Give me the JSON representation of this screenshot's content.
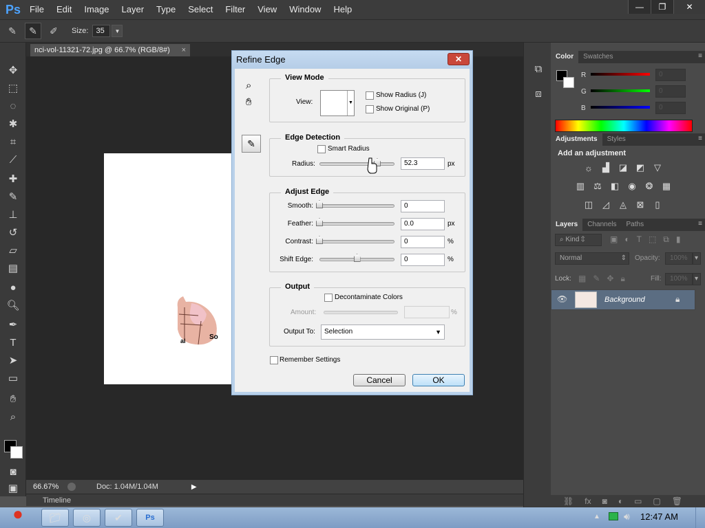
{
  "app": {
    "logo": "Ps",
    "menu": [
      "File",
      "Edit",
      "Image",
      "Layer",
      "Type",
      "Select",
      "Filter",
      "View",
      "Window",
      "Help"
    ]
  },
  "window_controls": {
    "minimize": "—",
    "restore": "❐",
    "close": "✕"
  },
  "options_bar": {
    "size_label": "Size:",
    "size_value": "35"
  },
  "document": {
    "tab_title": "nci-vol-11321-72.jpg @ 66.7% (RGB/8#)",
    "tab_close": "×",
    "zoom": "66.67%",
    "doc_info": "Doc: 1.04M/1.04M",
    "timeline_label": "Timeline"
  },
  "panels": {
    "color_tabs": [
      "Color",
      "Swatches"
    ],
    "rgb_labels": [
      "R",
      "G",
      "B"
    ],
    "rgb_values": [
      "0",
      "0",
      "0"
    ],
    "adjust_tabs": [
      "Adjustments",
      "Styles"
    ],
    "adjust_heading": "Add an adjustment",
    "layers_tabs": [
      "Layers",
      "Channels",
      "Paths"
    ],
    "layers_kind": "Kind",
    "blend_mode": "Normal",
    "opacity_label": "Opacity:",
    "opacity_value": "100%",
    "lock_label": "Lock:",
    "fill_label": "Fill:",
    "fill_value": "100%",
    "layer_name": "Background"
  },
  "dialog": {
    "title": "Refine Edge",
    "close": "✕",
    "view_mode": {
      "title": "View Mode",
      "view_label": "View:",
      "show_radius": "Show Radius (J)",
      "show_original": "Show Original (P)"
    },
    "edge_detection": {
      "title": "Edge Detection",
      "smart_radius": "Smart Radius",
      "radius_label": "Radius:",
      "radius_value": "52.3",
      "radius_unit": "px",
      "radius_level": 0.77
    },
    "adjust_edge": {
      "title": "Adjust Edge",
      "rows": [
        {
          "label": "Smooth:",
          "value": "0",
          "unit": "",
          "level": 0
        },
        {
          "label": "Feather:",
          "value": "0.0",
          "unit": "px",
          "level": 0
        },
        {
          "label": "Contrast:",
          "value": "0",
          "unit": "%",
          "level": 0
        },
        {
          "label": "Shift Edge:",
          "value": "0",
          "unit": "%",
          "level": 0.5
        }
      ]
    },
    "output": {
      "title": "Output",
      "decontaminate": "Decontaminate Colors",
      "amount_label": "Amount:",
      "amount_unit": "%",
      "output_to_label": "Output To:",
      "output_to_value": "Selection"
    },
    "remember": "Remember Settings",
    "cancel": "Cancel",
    "ok": "OK"
  },
  "taskbar": {
    "clock": "12:47 AM"
  },
  "colors": {
    "panel_bg": "#4a4a4a",
    "canvas_bg": "#282828",
    "dialog_bg": "#f0f0f0",
    "selected_layer": "#5b6d82",
    "taskbar": "#8dabd0"
  }
}
